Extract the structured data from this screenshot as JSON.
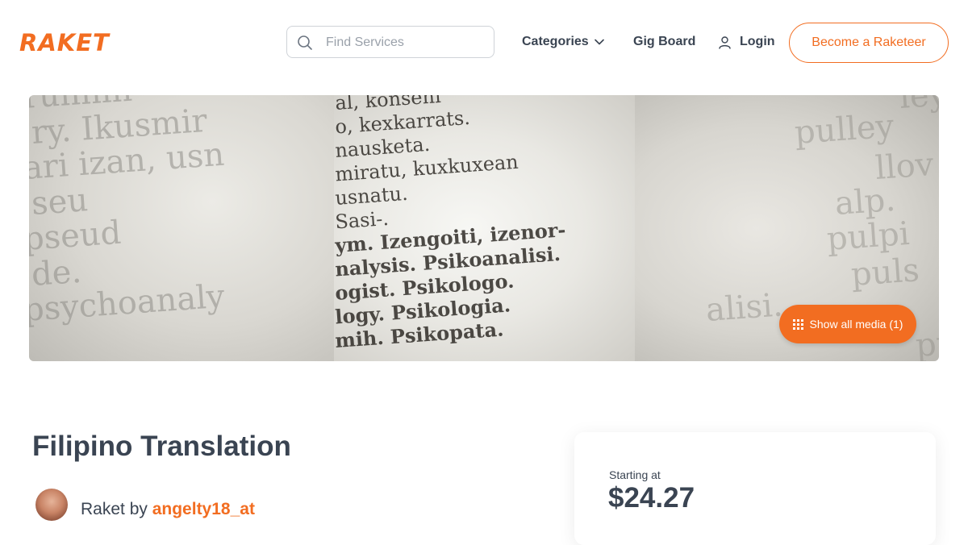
{
  "header": {
    "logo_text": "RAKET",
    "search": {
      "placeholder": "Find Services",
      "icon": "search-icon"
    },
    "nav": {
      "categories_label": "Categories",
      "gig_board_label": "Gig Board",
      "login_label": "Login"
    },
    "cta_label": "Become a Raketeer"
  },
  "hero": {
    "show_media_label": "Show all media (1)",
    "words": {
      "left": [
        "runnin",
        "ry. Ikusmir",
        "ari izan, usn",
        "seu",
        "pseud",
        "de.",
        "psychoanaly"
      ],
      "mid": [
        "al, konseni",
        "o, kexkarrats.",
        "nausketa.",
        "miratu, kuxkuxean",
        "usnatu.",
        "Sasi-.",
        "ym. Izengoiti, izenor-",
        "nalysis. Psikoanalisi.",
        "ogist. Psikologo.",
        "logy. Psikologia.",
        "mih. Psikopata."
      ],
      "right": [
        "ley",
        "pulley",
        "llov",
        "alp.",
        "pulpi",
        "puls",
        "alisi.",
        "pu"
      ]
    }
  },
  "gig": {
    "title": "Filipino Translation",
    "seller_prefix": "Raket by",
    "seller_name": "angelty18_at"
  },
  "pricing": {
    "starting_label": "Starting at",
    "price": "$24.27"
  },
  "colors": {
    "brand": "#f26d21",
    "text": "#3a4452",
    "border": "#cfd3d8"
  }
}
